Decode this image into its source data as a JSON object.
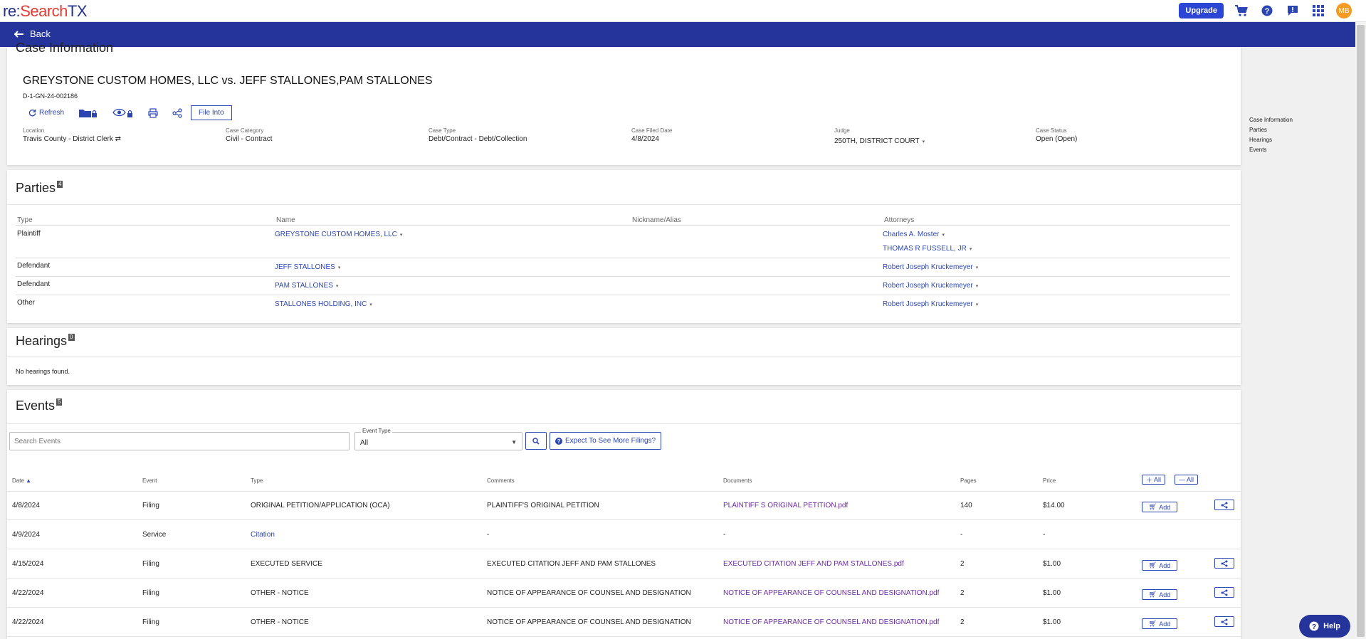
{
  "header": {
    "logo": {
      "re": "re:",
      "search": "Search",
      "tx": "TX"
    },
    "upgrade_label": "Upgrade",
    "avatar_initials": "MB"
  },
  "backbar": {
    "back_label": "Back"
  },
  "case_info": {
    "section_title": "Case Information",
    "title": "GREYSTONE CUSTOM HOMES, LLC vs. JEFF STALLONES,PAM STALLONES",
    "case_number": "D-1-GN-24-002186",
    "actions": {
      "refresh": "Refresh",
      "file_into": "File Into"
    },
    "fields": {
      "location_label": "Location",
      "location": "Travis County - District Clerk",
      "category_label": "Case Category",
      "category": "Civil - Contract",
      "type_label": "Case Type",
      "type": "Debt/Contract - Debt/Collection",
      "filed_label": "Case Filed Date",
      "filed": "4/8/2024",
      "judge_label": "Judge",
      "judge": "250TH, DISTRICT COURT",
      "status_label": "Case Status",
      "status": "Open (Open)"
    }
  },
  "parties": {
    "title": "Parties",
    "count": "4",
    "headers": {
      "type": "Type",
      "name": "Name",
      "nickname": "Nickname/Alias",
      "attorneys": "Attorneys"
    },
    "rows": [
      {
        "type": "Plaintiff",
        "name": "GREYSTONE CUSTOM HOMES, LLC",
        "attorney1": "Charles A. Moster",
        "attorney2": "THOMAS R FUSSELL, JR"
      },
      {
        "type": "Defendant",
        "name": "JEFF STALLONES",
        "attorney1": "Robert Joseph Kruckemeyer"
      },
      {
        "type": "Defendant",
        "name": "PAM STALLONES",
        "attorney1": "Robert Joseph Kruckemeyer"
      },
      {
        "type": "Other",
        "name": "STALLONES HOLDING, INC",
        "attorney1": "Robert Joseph Kruckemeyer"
      }
    ]
  },
  "hearings": {
    "title": "Hearings",
    "count": "0",
    "empty_text": "No hearings found."
  },
  "events": {
    "title": "Events",
    "count": "5",
    "search_placeholder": "Search Events",
    "event_type_label": "Event Type",
    "event_type_value": "All",
    "expect_label": "Expect To See More Filings?",
    "plus_all": "All",
    "minus_all": "All",
    "headers": {
      "date": "Date",
      "event": "Event",
      "type": "Type",
      "comments": "Comments",
      "documents": "Documents",
      "pages": "Pages",
      "price": "Price"
    },
    "add_label": "Add",
    "rows": [
      {
        "date": "4/8/2024",
        "event": "Filing",
        "type": "ORIGINAL PETITION/APPLICATION (OCA)",
        "comments": "PLAINTIFF'S ORIGINAL PETITION",
        "document": "PLAINTIFF S ORIGINAL PETITION.pdf",
        "pages": "140",
        "price": "$14.00"
      },
      {
        "date": "4/9/2024",
        "event": "Service",
        "type": "Citation",
        "comments": "-",
        "document": "-",
        "pages": "-",
        "price": "-"
      },
      {
        "date": "4/15/2024",
        "event": "Filing",
        "type": "EXECUTED SERVICE",
        "comments": "EXECUTED CITATION JEFF AND PAM STALLONES",
        "document": "EXECUTED CITATION JEFF AND PAM STALLONES.pdf",
        "pages": "2",
        "price": "$1.00"
      },
      {
        "date": "4/22/2024",
        "event": "Filing",
        "type": "OTHER - NOTICE",
        "comments": "NOTICE OF APPEARANCE OF COUNSEL AND DESIGNATION",
        "document": "NOTICE OF APPEARANCE OF COUNSEL AND DESIGNATION.pdf",
        "pages": "2",
        "price": "$1.00"
      },
      {
        "date": "4/22/2024",
        "event": "Filing",
        "type": "OTHER - NOTICE",
        "comments": "NOTICE OF APPEARANCE OF COUNSEL AND DESIGNATION",
        "document": "NOTICE OF APPEARANCE OF COUNSEL AND DESIGNATION.pdf",
        "pages": "2",
        "price": "$1.00"
      }
    ]
  },
  "sidenav": [
    "Case Information",
    "Parties",
    "Hearings",
    "Events"
  ],
  "help": {
    "label": "Help"
  },
  "colors": {
    "brand_blue": "#24349a",
    "link": "#2b46b3",
    "doc_link": "#6a2aa3",
    "logo_red": "#e53a2f",
    "avatar": "#f59a23"
  }
}
